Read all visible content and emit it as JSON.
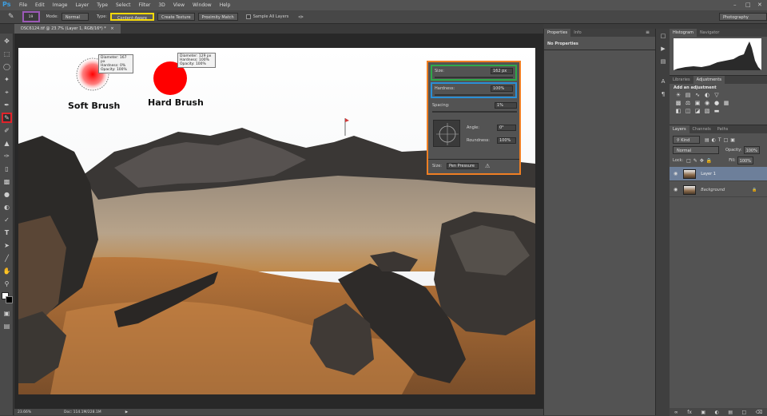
{
  "app": {
    "logo": "Ps"
  },
  "menu": [
    "File",
    "Edit",
    "Image",
    "Layer",
    "Type",
    "Select",
    "Filter",
    "3D",
    "View",
    "Window",
    "Help"
  ],
  "window_controls": [
    "–",
    "□",
    "✕"
  ],
  "options_bar": {
    "brush_size": "19",
    "mode_label": "Mode:",
    "mode_value": "Normal",
    "type_label": "Type:",
    "type_content_aware": "Content-Aware",
    "type_create_texture": "Create Texture",
    "type_proximity_match": "Proximity Match",
    "sample_all_layers": "Sample All Layers",
    "workspace": "Photography"
  },
  "document": {
    "tab_title": "DSC6124.tif @ 23.7% (Layer 1, RGB/16*) *",
    "zoom": "23.66%",
    "doc_info": "Doc: 114.1M/228.1M"
  },
  "canvas_labels": {
    "soft_brush": "Soft Brush",
    "hard_brush": "Hard Brush"
  },
  "soft_hud": {
    "diameter_label": "Diameter:",
    "diameter": "167 px",
    "hardness_label": "Hardness:",
    "hardness": "0%",
    "opacity_label": "Opacity:",
    "opacity": "100%"
  },
  "hard_hud": {
    "diameter_label": "Diameter:",
    "diameter": "129 px",
    "hardness_label": "Hardness:",
    "hardness": "100%",
    "opacity_label": "Opacity:",
    "opacity": "100%"
  },
  "brush_popup": {
    "size_label": "Size:",
    "size_value": "162 px",
    "hardness_label": "Hardness:",
    "hardness_value": "100%",
    "spacing_label": "Spacing:",
    "spacing_value": "1%",
    "angle_label": "Angle:",
    "angle_value": "0°",
    "roundness_label": "Roundness:",
    "roundness_value": "100%",
    "size_control_label": "Size:",
    "size_control_value": "Pen Pressure"
  },
  "properties_panel": {
    "tabs": [
      "Properties",
      "Info"
    ],
    "content": "No Properties"
  },
  "histogram_panel": {
    "tabs": [
      "Histogram",
      "Navigator"
    ]
  },
  "adjustments_panel": {
    "tabs": [
      "Libraries",
      "Adjustments"
    ],
    "title": "Add an adjustment"
  },
  "layers_panel": {
    "tabs": [
      "Layers",
      "Channels",
      "Paths"
    ],
    "kind": "Kind",
    "blend_mode": "Normal",
    "opacity_label": "Opacity:",
    "opacity": "100%",
    "lock_label": "Lock:",
    "fill_label": "Fill:",
    "fill": "100%",
    "layers": [
      {
        "name": "Layer 1",
        "selected": true
      },
      {
        "name": "Background",
        "selected": false
      }
    ]
  },
  "highlight_colors": {
    "tool_preset": "#9b59b6",
    "brush_tool": "#e0232a",
    "content_aware": "#f5d90a",
    "brush_panel": "#f07f23",
    "size_row": "#2ea84a",
    "hardness_row": "#2a8fd6"
  }
}
